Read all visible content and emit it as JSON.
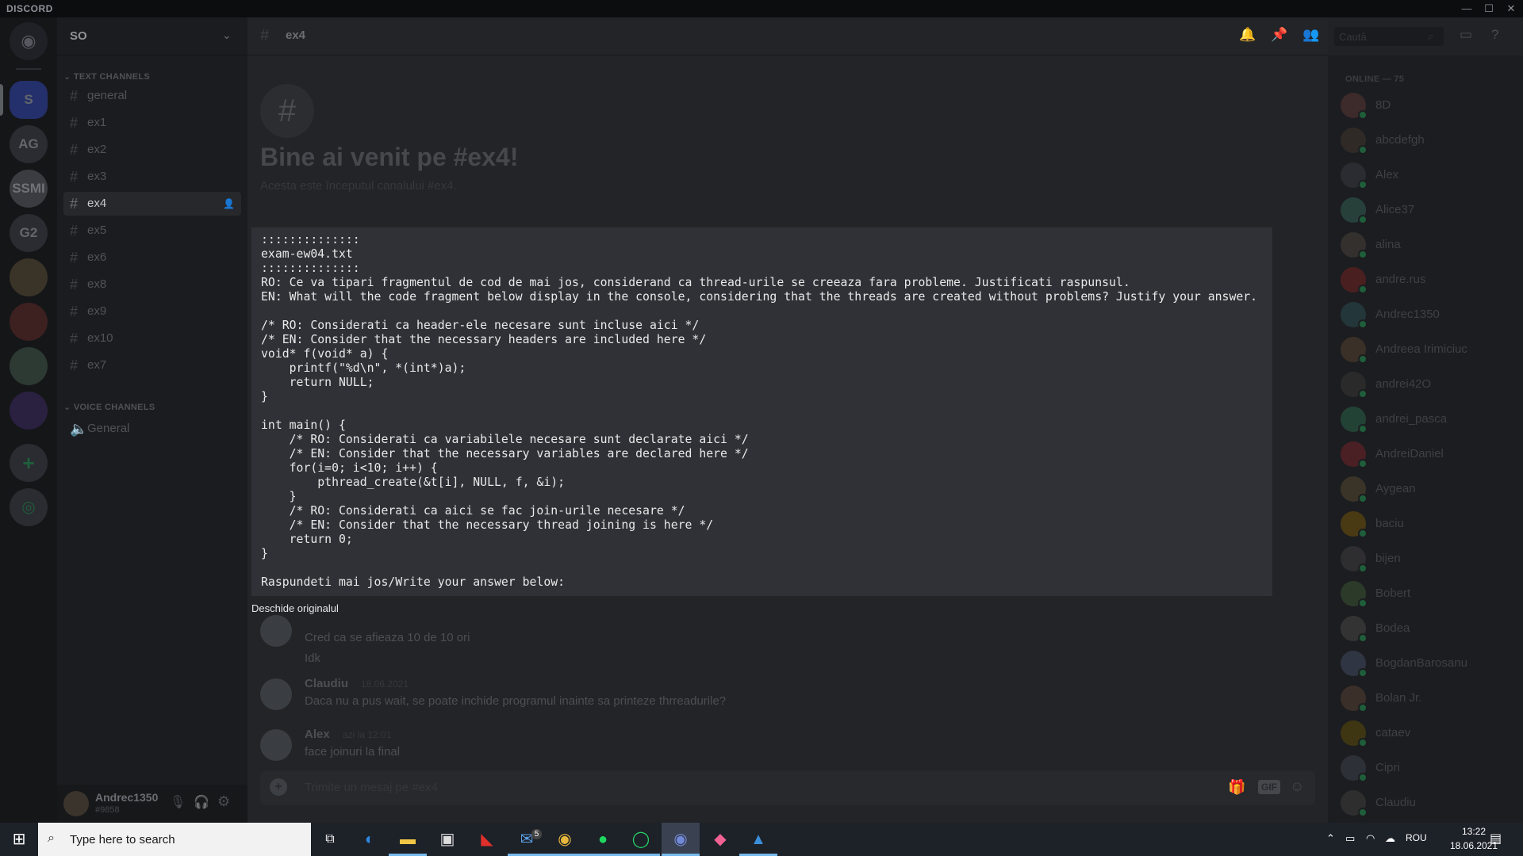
{
  "app": {
    "title": "DISCORD"
  },
  "window_controls": {
    "minimize": "—",
    "maximize": "☐",
    "close": "✕"
  },
  "guilds": [
    {
      "label": "S",
      "color": "#2f3d8f"
    },
    {
      "label": "AG",
      "color": "#2c2e33"
    },
    {
      "label": "SSMI",
      "color": "#3b3d42"
    },
    {
      "label": "G2",
      "color": "#2c2e33"
    }
  ],
  "server": {
    "name": "SO"
  },
  "categories": {
    "text": "TEXT CHANNELS",
    "voice": "VOICE CHANNELS"
  },
  "text_channels": [
    "general",
    "ex1",
    "ex2",
    "ex3",
    "ex4",
    "ex5",
    "ex6",
    "ex8",
    "ex9",
    "ex10",
    "ex7"
  ],
  "active_channel": "ex4",
  "voice_channels": [
    "General"
  ],
  "user": {
    "name": "Andrec1350",
    "tag": "#9858"
  },
  "header": {
    "channel": "ex4",
    "search_placeholder": "Caută"
  },
  "welcome": {
    "title": "Bine ai venit pe #ex4!",
    "subtitle": "Acesta este începutul canalului #ex4."
  },
  "code_text": "::::::::::::::\nexam-ew04.txt\n::::::::::::::\nRO: Ce va tipari fragmentul de cod de mai jos, considerand ca thread-urile se creeaza fara probleme. Justificati raspunsul.\nEN: What will the code fragment below display in the console, considering that the threads are created without problems? Justify your answer.\n\n/* RO: Considerati ca header-ele necesare sunt incluse aici */\n/* EN: Consider that the necessary headers are included here */\nvoid* f(void* a) {\n    printf(\"%d\\n\", *(int*)a);\n    return NULL;\n}\n\nint main() {\n    /* RO: Considerati ca variabilele necesare sunt declarate aici */\n    /* EN: Consider that the necessary variables are declared here */\n    for(i=0; i<10; i++) {\n        pthread_create(&t[i], NULL, f, &i);\n    }\n    /* RO: Considerati ca aici se fac join-urile necesare */\n    /* EN: Consider that the necessary thread joining is here */\n    return 0;\n}\n\nRaspundeti mai jos/Write your answer below:",
  "open_original": "Deschide originalul",
  "messages": [
    {
      "author": "",
      "time": "",
      "lines": [
        "Cred ca se afieaza 10 de 10 ori",
        "Idk"
      ]
    },
    {
      "author": "Claudiu",
      "time": "18.06.2021",
      "lines": [
        "Daca nu a pus wait, se poate inchide programul inainte sa printeze thrreadurile?"
      ]
    },
    {
      "author": "Alex",
      "time": "azi la 12:01",
      "lines": [
        "face joinuri la final"
      ]
    }
  ],
  "composer": {
    "placeholder": "Trimite un mesaj pe #ex4"
  },
  "members": {
    "heading": "ONLINE — 75",
    "list": [
      "8D",
      "abcdefgh",
      "Alex",
      "Alice37",
      "alina",
      "andre.rus",
      "Andrec1350",
      "Andreea Irimiciuc",
      "andrei42O",
      "andrei_pasca",
      "AndreiDaniel",
      "Aygean",
      "baciu",
      "bijen",
      "Bobert",
      "Bodea",
      "BogdanBarosanu",
      "Bolan Jr.",
      "cataev",
      "Cipri",
      "Claudiu"
    ]
  },
  "taskbar": {
    "search_placeholder": "Type here to search",
    "mail_badge": "5",
    "lang": "ROU",
    "time": "13:22",
    "date": "18.06.2021"
  },
  "icons": {
    "bell": "bell-icon",
    "pin": "pin-icon",
    "members": "members-icon",
    "inbox": "inbox-icon",
    "help": "help-icon"
  }
}
